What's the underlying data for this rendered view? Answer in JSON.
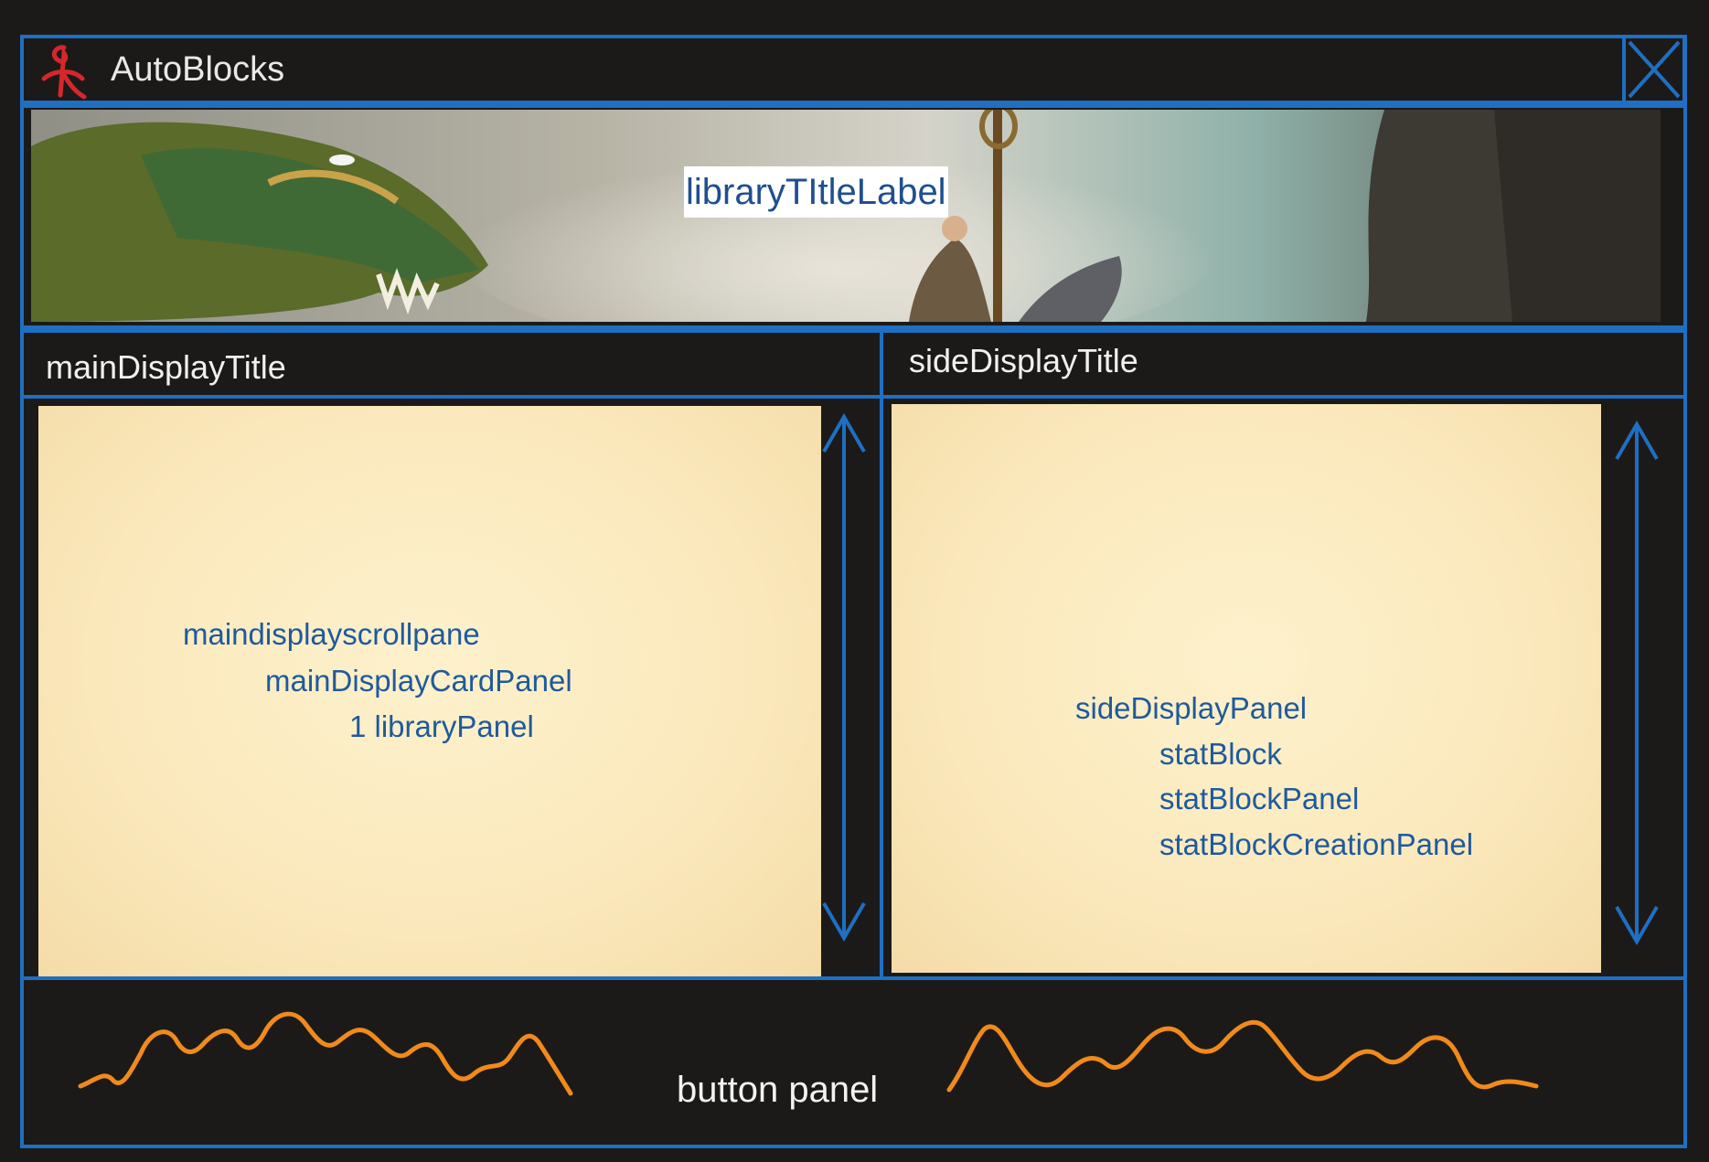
{
  "window": {
    "title": "AutoBlocks",
    "close_icon": "close-x-icon"
  },
  "banner": {
    "label": "libraryTItleLabel"
  },
  "main_display": {
    "title": "mainDisplayTitle",
    "lines": [
      "maindisplayscrollpane",
      "mainDisplayCardPanel",
      "1 libraryPanel"
    ]
  },
  "side_display": {
    "title": "sideDisplayTitle",
    "lines": [
      "sideDisplayPanel",
      "statBlock",
      "statBlockPanel",
      "statBlockCreationPanel"
    ]
  },
  "button_panel": {
    "label": "button panel"
  },
  "colors": {
    "frame_blue": "#1f6fc2",
    "background": "#1c1a19",
    "parchment": "#fbe9bd",
    "panel_text": "#1f5a9c",
    "squiggle_orange": "#f08a1c",
    "logo_red": "#d4282c"
  }
}
